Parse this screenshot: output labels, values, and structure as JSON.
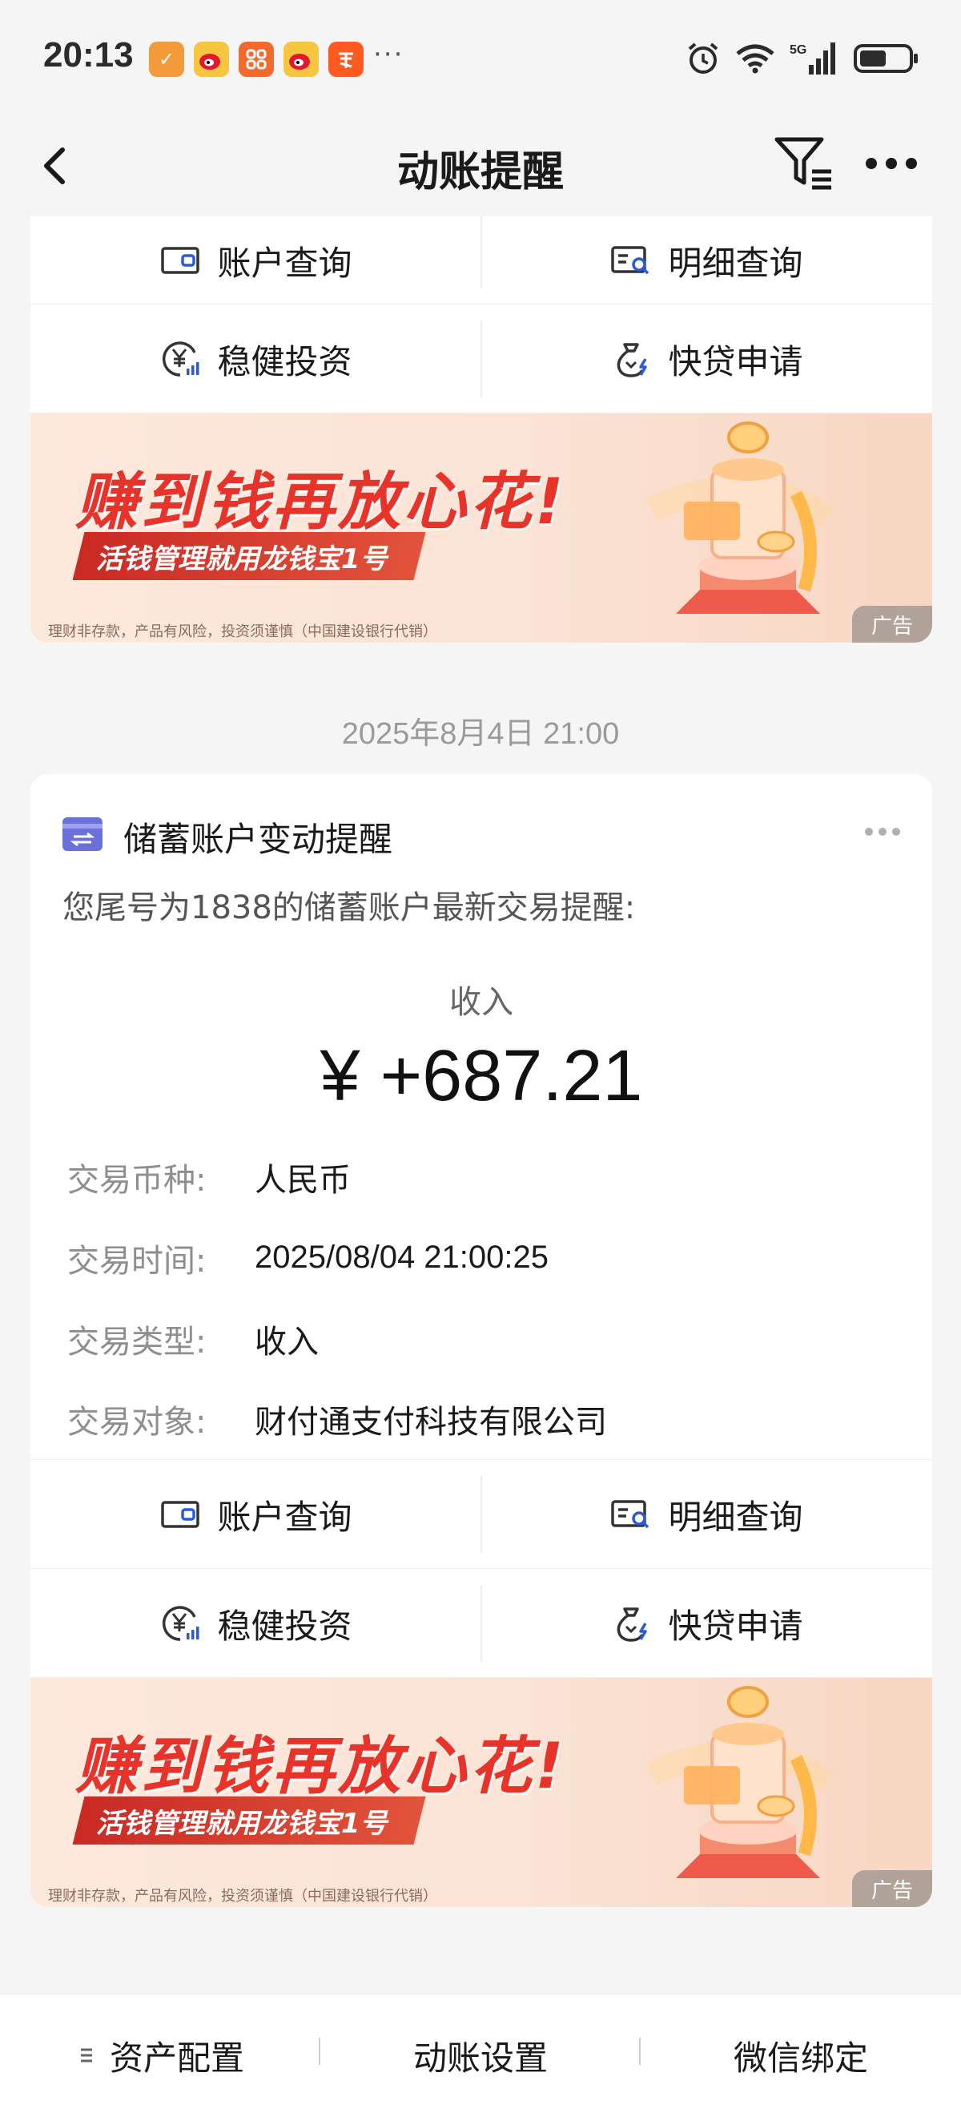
{
  "status_bar": {
    "time": "20:13",
    "notif_more": "···",
    "network": "5G"
  },
  "nav": {
    "title": "动账提醒"
  },
  "action_buttons": {
    "account_query": "账户查询",
    "detail_query": "明细查询",
    "steady_invest": "稳健投资",
    "quick_loan": "快贷申请"
  },
  "banner": {
    "headline": "赚到钱再放心花!",
    "tagline": "活钱管理就用龙钱宝1号",
    "disclaimer": "理财非存款，产品有风险，投资须谨慎（中国建设银行代销）",
    "ad_label": "广告"
  },
  "timestamp": "2025年8月4日 21:00",
  "notification": {
    "title": "储蓄账户变动提醒",
    "intro": "您尾号为1838的储蓄账户最新交易提醒:",
    "type_label": "收入",
    "amount": "¥ +687.21",
    "details": [
      {
        "label": "交易币种:",
        "value": "人民币"
      },
      {
        "label": "交易时间:",
        "value": "2025/08/04 21:00:25"
      },
      {
        "label": "交易类型:",
        "value": "收入"
      },
      {
        "label": "交易对象:",
        "value": "财付通支付科技有限公司"
      }
    ]
  },
  "tab_bar": {
    "asset_config": "资产配置",
    "account_settings": "动账设置",
    "wechat_bind": "微信绑定"
  }
}
